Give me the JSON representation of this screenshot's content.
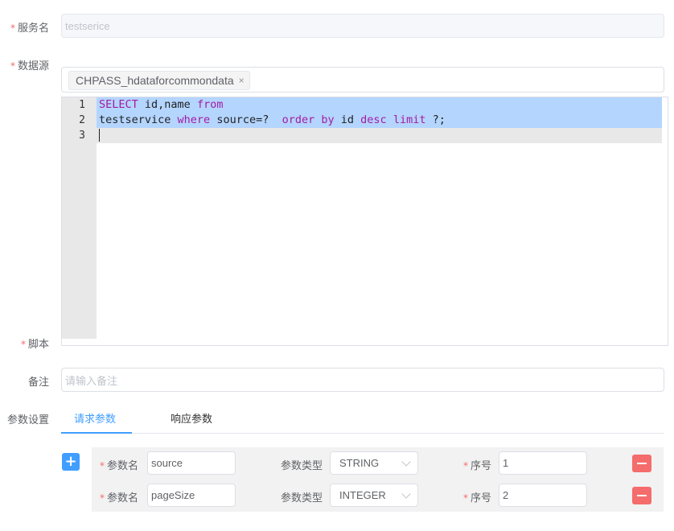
{
  "form": {
    "service_name": {
      "label": "服务名",
      "value": "testserice"
    },
    "datasource": {
      "label": "数据源",
      "tag": "CHPASS_hdataforcommondata",
      "tag_close": "×"
    },
    "script": {
      "label": "脚本",
      "line_numbers": [
        "1",
        "2",
        "3"
      ],
      "line1": [
        {
          "t": "SELECT",
          "kw": true
        },
        {
          "t": " id,name ",
          "kw": false
        },
        {
          "t": "from",
          "kw": true
        }
      ],
      "line2": [
        {
          "t": "testservice ",
          "kw": false
        },
        {
          "t": "where",
          "kw": true
        },
        {
          "t": " source=?  ",
          "kw": false
        },
        {
          "t": "order",
          "kw": true
        },
        {
          "t": " ",
          "kw": false
        },
        {
          "t": "by",
          "kw": true
        },
        {
          "t": " id ",
          "kw": false
        },
        {
          "t": "desc",
          "kw": true
        },
        {
          "t": " ",
          "kw": false
        },
        {
          "t": "limit",
          "kw": true
        },
        {
          "t": " ?;",
          "kw": false
        }
      ]
    },
    "remark": {
      "label": "备注",
      "placeholder": "请输入备注"
    },
    "params_label": "参数设置"
  },
  "tabs": [
    {
      "label": "请求参数",
      "active": true
    },
    {
      "label": "响应参数",
      "active": false
    }
  ],
  "params": {
    "add_icon": "plus-icon",
    "name_label": "参数名",
    "type_label": "参数类型",
    "order_label": "序号",
    "rows": [
      {
        "name": "source",
        "type": "STRING",
        "order": "1"
      },
      {
        "name": "pageSize",
        "type": "INTEGER",
        "order": "2"
      }
    ]
  },
  "colors": {
    "primary": "#409eff",
    "danger": "#f56c6c",
    "selection": "#b4d5fe",
    "keyword": "#a31ba3"
  }
}
